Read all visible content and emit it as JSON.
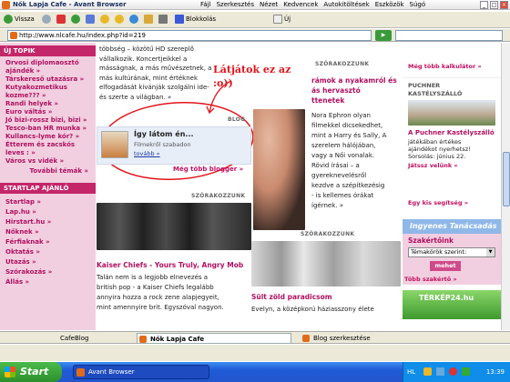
{
  "window": {
    "title": "Nők Lapja Cafe - Avant Browser"
  },
  "menu": [
    "Fájl",
    "Szerkesztés",
    "Nézet",
    "Kedvencek",
    "Autokitöltések",
    "Eszközök",
    "Súgó"
  ],
  "toolbar": {
    "back": "Vissza",
    "blocker": "Blokkolás",
    "new": "Új"
  },
  "address": {
    "url": "http://www.nlcafe.hu/index.php?id=219"
  },
  "sidebar": {
    "topic_header": "ÚJ TOPIK",
    "topics": [
      "Orvosi diplomaosztó",
      "ajándék »",
      "Társkereső utazásra »",
      "Kutyakozmetikus",
      "kozme??? »",
      "Randi helyek »",
      "Euro váltás »",
      "Jó bizi-rossz bizi, bizi »",
      "Tesco-ban HR munka »",
      "Kullancs-lyme kór? »",
      "Étterem és zacskós",
      "leves : »",
      "Város vs vidék »"
    ],
    "topics_more": "További témák »",
    "startlap_header": "STARTLAP AJÁNLÓ",
    "links": [
      "Startlap »",
      "Lap.hu »",
      "Hirstart.hu »",
      "Nőknek »",
      "Férfiaknak »",
      "Oktatás »",
      "Utazás »",
      "Szórakozás »",
      "Állás »"
    ]
  },
  "main": {
    "intro": [
      "többség – közötű HD szereplő",
      "vállalkozik. Koncertjeikkel a",
      "másságnak, a más művészetnek, a",
      "más kultúrának, mint értéknek",
      "elfogadását kívánják szolgálni ide-",
      "és szerte a világban. »"
    ],
    "annotation": [
      "Látjátok ez az",
      ":o))"
    ],
    "blog_label": "BLOG",
    "blog_title": "Így látom én...",
    "blog_sub": "Filmekről szabadon",
    "blog_more": "tovább »",
    "more_blogger": "Még több blogger »",
    "section_label_a": "SZÓRAKOZZUNK",
    "section_label_b": "SZÓRAKOZZUNK",
    "section_label_c": "SZÓRAKOZZUNK",
    "right_headline": [
      "rámok a nyakamról és",
      "ás hervasztó",
      "ttenetek"
    ],
    "nora": [
      "Nora Ephron olyan",
      "filmekkel dicsekedhet,",
      "mint a Harry és Sally, A",
      "szerelem hálójában,",
      "vagy a Női vonalak.",
      "Rövid írásai – a",
      "gyereknevelésről",
      "kezdve a szépítkezésig",
      "- is kellemes órákat",
      "ígérnek. »"
    ],
    "kaiser_title": "Kaiser Chiefs - Yours Truly, Angry Mob",
    "kaiser": [
      "Talán nem is a legjobb elnevezés a",
      "british pop - a Kaiser Chiefs legalább",
      "annyira hozza a rock zene alapjegyeit,",
      "mint amennyire brit. Egyszóval nagyon."
    ],
    "sult_title": "Sült zöld paradicsom",
    "sult": "Evelyn, a középkorú háziasszony élete"
  },
  "right": {
    "more_calc": "Még több kalkulátor »",
    "castle_header": [
      "PUCHNER",
      "KASTÉLYSZÁLLÓ"
    ],
    "castle_title": "A Puchner Kastélyszálló",
    "castle_text": [
      "játékában értékes",
      "ajándékot nyerhetsz!",
      "Sorsolás: június 22."
    ],
    "castle_link": "Játssz velünk »",
    "good_deed": "Egy kis segítség »",
    "advisor_banner": "Ingyenes Tanácsadás",
    "advisor_title": "Szakértőink",
    "advisor_select": "Témakörök szerint:",
    "advisor_go": "mehet",
    "advisor_more": "Több szakértő »",
    "map_banner": "TÉRKÉP24.hu"
  },
  "tabs": [
    "CafeBlog",
    "Nők Lapja Cafe",
    "Blog szerkesztése"
  ],
  "taskbar": {
    "start": "Start",
    "app": "Avant Browser",
    "lang": "HL",
    "time": "13:39"
  },
  "colors": {
    "brand_pink": "#c4266a",
    "sidebar_bg": "#f2cfe0",
    "annotation_red": "#e0151b",
    "taskbar_blue": "#2356cf"
  }
}
